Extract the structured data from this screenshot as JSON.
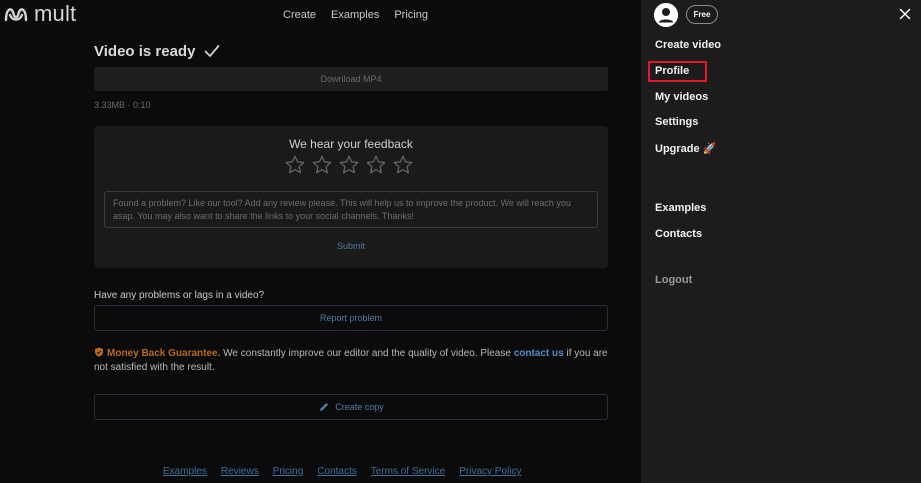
{
  "app": {
    "logo_text": "mult"
  },
  "topnav": [
    "Create",
    "Examples",
    "Pricing"
  ],
  "main": {
    "title": "Video is ready",
    "download_label": "Download MP4",
    "meta": "3.33MB · 0:10",
    "feedback": {
      "title": "We hear your feedback",
      "placeholder": "Found a problem? Like our tool? Add any review please. This will help us to improve the product. We will reach you asap. You may also want to share the links to your social channels. Thanks!",
      "submit": "Submit",
      "stars": 5
    },
    "problem_question": "Have any problems or lags in a video?",
    "report_button": "Report problem",
    "guarantee": {
      "label": "Money Back Guarantee.",
      "text_before": " We constantly improve our editor and the quality of video. Please ",
      "link": "contact us",
      "text_after": " if you are not satisfied with the result."
    },
    "copy_button": "Create copy"
  },
  "footer": [
    "Examples",
    "Reviews",
    "Pricing",
    "Contacts",
    "Terms of Service",
    "Privacy Policy"
  ],
  "panel": {
    "badge": "Free",
    "menu": [
      {
        "label": "Create video"
      },
      {
        "label": "Profile"
      },
      {
        "label": "My videos"
      },
      {
        "label": "Settings"
      },
      {
        "label": "Upgrade 🚀"
      },
      {
        "label": "Examples"
      },
      {
        "label": "Contacts"
      },
      {
        "label": "Logout"
      }
    ]
  },
  "colors": {
    "accent_blue": "#4f7ca8",
    "guarantee_orange": "#b86a22",
    "highlight_red": "#e1192b",
    "panel_bg": "#1c1c1c"
  }
}
